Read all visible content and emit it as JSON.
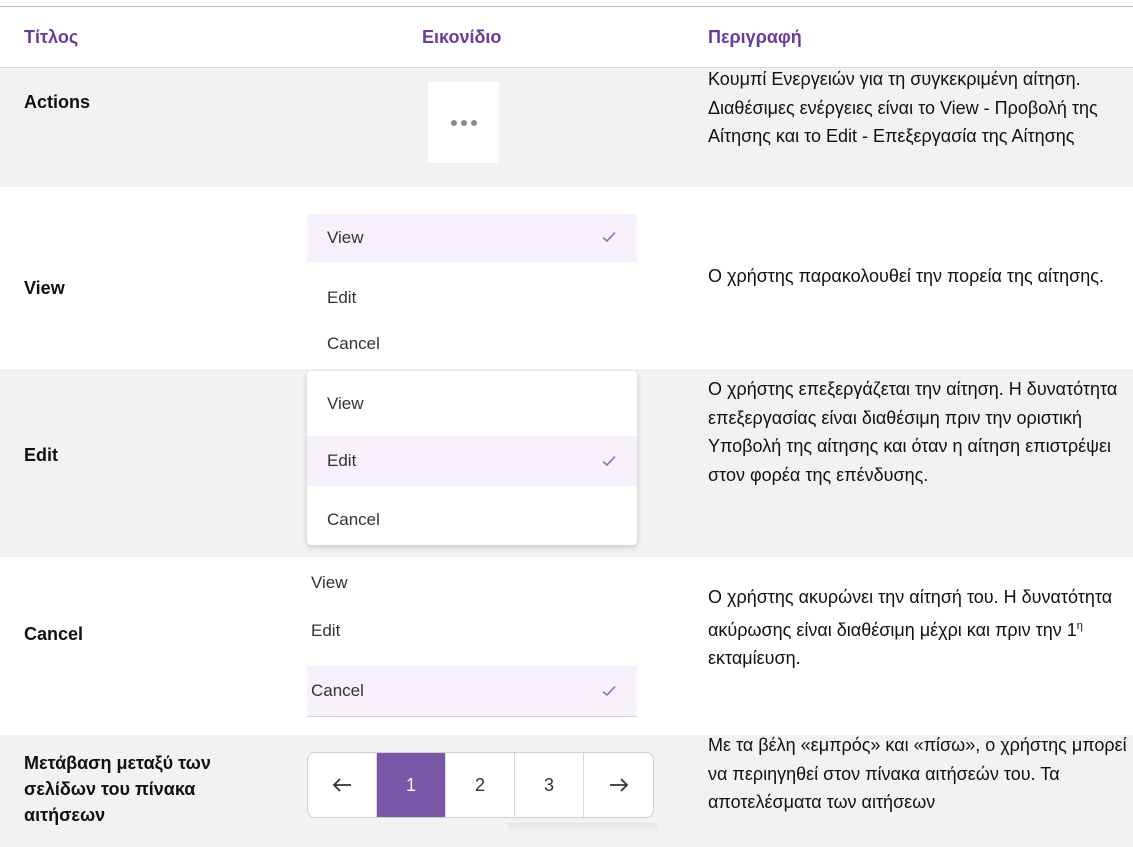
{
  "header": {
    "col_title": "Τίτλος",
    "col_icon": "Εικονίδιο",
    "col_desc": "Περιγραφή"
  },
  "rows": [
    {
      "title": "Actions",
      "icon": "more-horizontal-icon",
      "desc": "Κουμπί Ενεργειών για τη συγκεκριμένη αίτηση. Διαθέσιμες ενέργειες είναι το View - Προβολή της Αίτησης και το Edit - Επεξεργασία της Αίτησης"
    },
    {
      "title": "View",
      "menu": [
        "View",
        "Edit",
        "Cancel"
      ],
      "selected": "View",
      "desc": "Ο χρήστης παρακολουθεί την πορεία της αίτησης."
    },
    {
      "title": "Edit",
      "menu": [
        "View",
        "Edit",
        "Cancel"
      ],
      "selected": "Edit",
      "desc": "Ο χρήστης επεξεργάζεται την αίτηση. Η δυνατότητα επεξεργασίας είναι διαθέσιμη πριν την οριστική Υποβολή της αίτησης και όταν η αίτηση επιστρέψει στον φορέα της επένδυσης."
    },
    {
      "title": "Cancel",
      "menu": [
        "View",
        "Edit",
        "Cancel"
      ],
      "selected": "Cancel",
      "desc_pre": "Ο χρήστης ακυρώνει την αίτησή του. Η δυνατότητα ακύρωσης είναι διαθέσιμη μέχρι και πριν την 1",
      "desc_sup": "η",
      "desc_post": " εκταμίευση."
    },
    {
      "title": "Μετάβαση μεταξύ των σελίδων του πίνακα αιτήσεων",
      "pager": {
        "prev_icon": "arrow-left-icon",
        "pages": [
          "1",
          "2",
          "3"
        ],
        "active": "1",
        "next_icon": "arrow-right-icon"
      },
      "desc": "Με τα βέλη «εμπρός» και «πίσω», ο χρήστης μπορεί να περιηγηθεί στον πίνακα αιτήσεών του. Τα αποτελέσματα των αιτήσεων"
    }
  ],
  "colors": {
    "header_text": "#6b3aa0",
    "row_bg": "#f2f2f2",
    "pager_active": "#7a56a6",
    "check": "#8e6fbf"
  }
}
